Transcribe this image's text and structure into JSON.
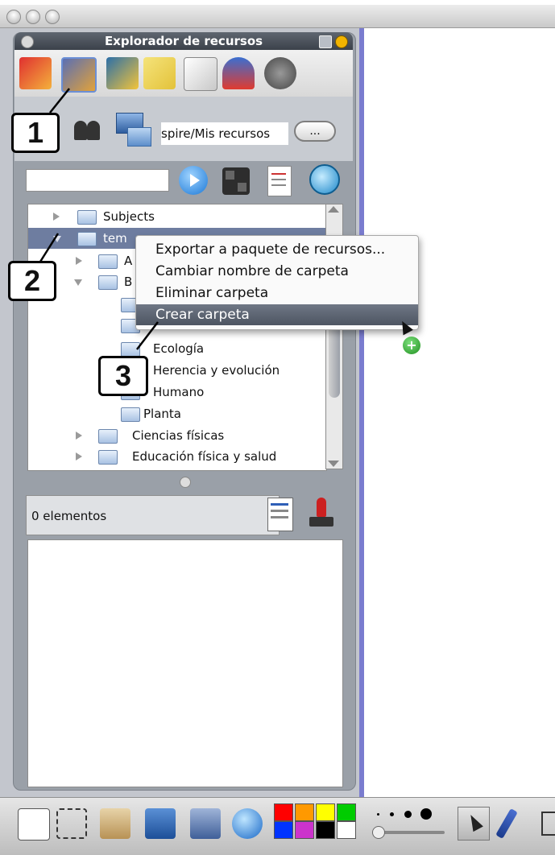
{
  "panel": {
    "title": "Explorador de recursos",
    "path_value": "spire/Mis recursos",
    "browse_label": "...",
    "search_placeholder": ""
  },
  "tree": {
    "rows": [
      {
        "label": "Subjects",
        "expanded": false
      },
      {
        "label": "tem",
        "expanded": true,
        "selected": true
      },
      {
        "label": "A",
        "expanded": false
      },
      {
        "label": "B",
        "expanded": true
      },
      {
        "label": "Ecología"
      },
      {
        "label": "Herencia y evolución"
      },
      {
        "label": "Humano"
      },
      {
        "label": "Planta"
      },
      {
        "label": "Ciencias físicas",
        "expanded": false
      },
      {
        "label": "Educación física y salud",
        "expanded": false
      }
    ]
  },
  "context_menu": {
    "items": [
      {
        "label": "Exportar a paquete de recursos..."
      },
      {
        "label": "Cambiar nombre de carpeta"
      },
      {
        "label": "Eliminar carpeta"
      },
      {
        "label": "Crear carpeta",
        "highlighted": true
      }
    ]
  },
  "callouts": {
    "one": "1",
    "two": "2",
    "three": "3"
  },
  "resources": {
    "count_label": "0 elementos"
  },
  "toolbar": {
    "colors": [
      "#ff0000",
      "#ff9900",
      "#ffff00",
      "#00cc00",
      "#0033ff",
      "#cc33cc",
      "#000000",
      "#ffffff"
    ]
  }
}
